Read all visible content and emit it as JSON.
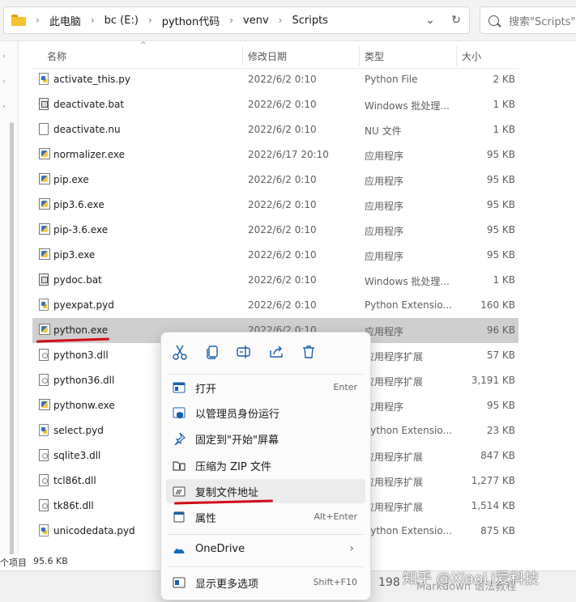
{
  "address": {
    "crumbs": [
      "此电脑",
      "bc (E:)",
      "python代码",
      "venv",
      "Scripts"
    ],
    "search_placeholder": "搜索\"Scripts\""
  },
  "columns": {
    "name": "名称",
    "date": "修改日期",
    "type": "类型",
    "size": "大小"
  },
  "files": [
    {
      "icon": "python-file-icon",
      "name": "activate_this.py",
      "date": "2022/6/2 0:10",
      "type": "Python File",
      "size": "2 KB"
    },
    {
      "icon": "batch-file-icon",
      "name": "deactivate.bat",
      "date": "2022/6/2 0:10",
      "type": "Windows 批处理...",
      "size": "1 KB"
    },
    {
      "icon": "document-icon",
      "name": "deactivate.nu",
      "date": "2022/6/2 0:10",
      "type": "NU 文件",
      "size": "1 KB"
    },
    {
      "icon": "exe-icon",
      "name": "normalizer.exe",
      "date": "2022/6/17 20:10",
      "type": "应用程序",
      "size": "95 KB"
    },
    {
      "icon": "exe-icon",
      "name": "pip.exe",
      "date": "2022/6/2 0:10",
      "type": "应用程序",
      "size": "95 KB"
    },
    {
      "icon": "exe-icon",
      "name": "pip3.6.exe",
      "date": "2022/6/2 0:10",
      "type": "应用程序",
      "size": "95 KB"
    },
    {
      "icon": "exe-icon",
      "name": "pip-3.6.exe",
      "date": "2022/6/2 0:10",
      "type": "应用程序",
      "size": "95 KB"
    },
    {
      "icon": "exe-icon",
      "name": "pip3.exe",
      "date": "2022/6/2 0:10",
      "type": "应用程序",
      "size": "95 KB"
    },
    {
      "icon": "batch-file-icon",
      "name": "pydoc.bat",
      "date": "2022/6/2 0:10",
      "type": "Windows 批处理...",
      "size": "1 KB"
    },
    {
      "icon": "python-file-icon",
      "name": "pyexpat.pyd",
      "date": "2022/6/2 0:10",
      "type": "Python Extensio...",
      "size": "160 KB"
    },
    {
      "icon": "python-exe-icon",
      "name": "python.exe",
      "date": "2022/6/2 0:10",
      "type": "应用程序",
      "size": "96 KB",
      "selected": true
    },
    {
      "icon": "dll-icon",
      "name": "python3.dll",
      "date": "",
      "type": "应用程序扩展",
      "size": "57 KB"
    },
    {
      "icon": "dll-icon",
      "name": "python36.dll",
      "date": "",
      "type": "应用程序扩展",
      "size": "3,191 KB"
    },
    {
      "icon": "exe-icon",
      "name": "pythonw.exe",
      "date": "",
      "type": "应用程序",
      "size": "95 KB"
    },
    {
      "icon": "python-file-icon",
      "name": "select.pyd",
      "date": "",
      "type": "Python Extensio...",
      "size": "23 KB"
    },
    {
      "icon": "dll-icon",
      "name": "sqlite3.dll",
      "date": "",
      "type": "应用程序扩展",
      "size": "847 KB"
    },
    {
      "icon": "dll-icon",
      "name": "tcl86t.dll",
      "date": "",
      "type": "应用程序扩展",
      "size": "1,277 KB"
    },
    {
      "icon": "dll-icon",
      "name": "tk86t.dll",
      "date": "",
      "type": "应用程序扩展",
      "size": "1,514 KB"
    },
    {
      "icon": "python-file-icon",
      "name": "unicodedata.pyd",
      "date": "",
      "type": "Python Extensio...",
      "size": "875 KB"
    }
  ],
  "status": {
    "count": "个项目",
    "size": "95.6 KB"
  },
  "taskstrip": {
    "number": "198",
    "text": "Markdown 语法教程"
  },
  "watermark": "知乎 @XiaoLi爱科技",
  "context_menu": {
    "quick_actions": [
      "cut-icon",
      "copy-icon",
      "rename-icon",
      "share-icon",
      "delete-icon"
    ],
    "items": [
      {
        "icon": "open-icon",
        "label": "打开",
        "shortcut": "Enter"
      },
      {
        "icon": "admin-shield-icon",
        "label": "以管理员身份运行",
        "shortcut": ""
      },
      {
        "icon": "pin-icon",
        "label": "固定到\"开始\"屏幕",
        "shortcut": ""
      },
      {
        "icon": "zip-icon",
        "label": "压缩为 ZIP 文件",
        "shortcut": ""
      },
      {
        "icon": "copy-path-icon",
        "label": "复制文件地址",
        "shortcut": ""
      },
      {
        "icon": "properties-icon",
        "label": "属性",
        "shortcut": "Alt+Enter"
      },
      {
        "icon": "onedrive-icon",
        "label": "OneDrive",
        "shortcut": "",
        "submenu": true
      },
      {
        "icon": "more-options-icon",
        "label": "显示更多选项",
        "shortcut": "Shift+F10"
      }
    ]
  },
  "colors": {
    "accent_red": "#d10d15",
    "selected_row": "#cfcfcf",
    "onedrive_blue": "#0f6cbd"
  }
}
